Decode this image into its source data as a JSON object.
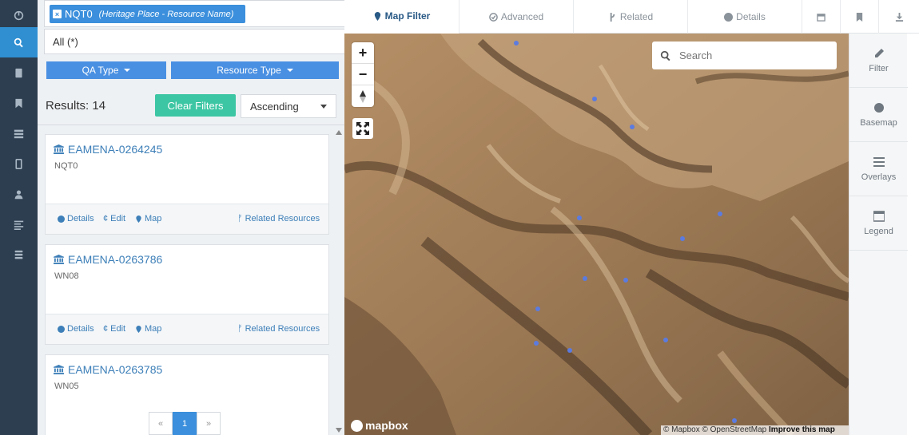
{
  "nav_rail": {
    "items": [
      {
        "id": "dashboard",
        "icon": "dashboard-icon"
      },
      {
        "id": "search",
        "icon": "search-icon",
        "active": true
      },
      {
        "id": "tablet",
        "icon": "tablet-icon"
      },
      {
        "id": "bookmark",
        "icon": "bookmark-icon"
      },
      {
        "id": "grid",
        "icon": "grid-icon"
      },
      {
        "id": "book",
        "icon": "book-icon"
      },
      {
        "id": "user",
        "icon": "user-icon"
      },
      {
        "id": "list",
        "icon": "list-icon"
      },
      {
        "id": "database",
        "icon": "database-icon"
      }
    ]
  },
  "search": {
    "term_chip": {
      "label": "NQT0",
      "sublabel": "(Heritage Place - Resource Name)"
    },
    "scope_select": "All (*)",
    "filters": [
      {
        "label": "QA Type"
      },
      {
        "label": "Resource Type"
      }
    ],
    "results_label": "Results: 14",
    "clear_filters": "Clear Filters",
    "sort_select": "Ascending"
  },
  "results": [
    {
      "id": "EAMENA-0264245",
      "code": "NQT0"
    },
    {
      "id": "EAMENA-0263786",
      "code": "WN08"
    },
    {
      "id": "EAMENA-0263785",
      "code": "WN05"
    }
  ],
  "card_actions": {
    "details": "Details",
    "edit": "Edit",
    "map": "Map",
    "related": "Related Resources"
  },
  "pagination": {
    "prev": "«",
    "current": "1",
    "next": "»"
  },
  "tabs": [
    {
      "label": "Map Filter",
      "icon": "map-marker-icon",
      "active": true
    },
    {
      "label": "Advanced",
      "icon": "check-circle-icon"
    },
    {
      "label": "Related",
      "icon": "code-fork-icon"
    },
    {
      "label": "Details",
      "icon": "info-icon"
    }
  ],
  "tab_icons": [
    "calendar-icon",
    "bookmark-icon",
    "download-icon"
  ],
  "map": {
    "search_placeholder": "Search",
    "zoom_in": "+",
    "zoom_out": "−",
    "logo_text": "mapbox",
    "attribution": {
      "prefix": "© Mapbox © OpenStreetMap",
      "link": "Improve this map"
    },
    "point_color": "#5b7be0"
  },
  "side_tools": [
    {
      "label": "Filter",
      "icon": "pencil-icon"
    },
    {
      "label": "Basemap",
      "icon": "globe-icon"
    },
    {
      "label": "Overlays",
      "icon": "list-icon"
    },
    {
      "label": "Legend",
      "icon": "legend-icon"
    }
  ],
  "colors": {
    "rail": "#2d3e50",
    "accent": "#3b8fdc",
    "clear": "#3dc6a3",
    "link": "#3d7fb8"
  }
}
